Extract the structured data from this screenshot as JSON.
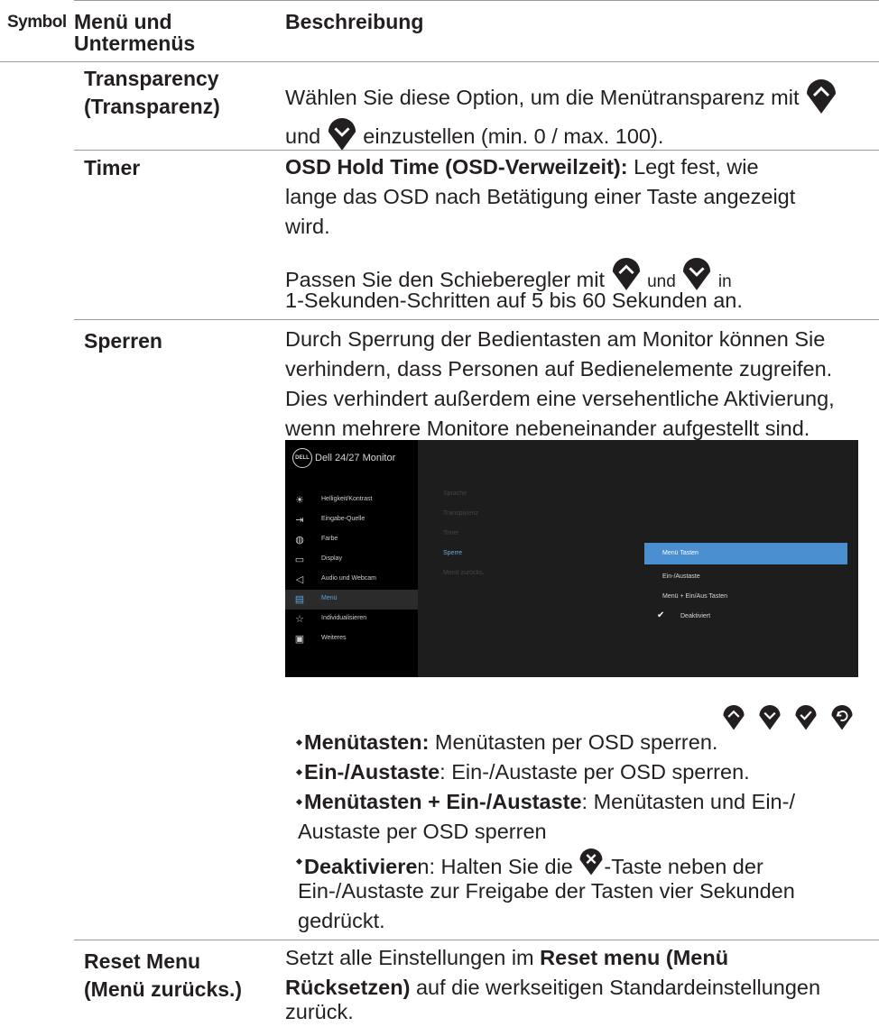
{
  "header": {
    "col_symbol": "Symbol",
    "col_menu_line1": "Menü und",
    "col_menu_line2": "Untermenüs",
    "col_desc": "Beschreibung"
  },
  "rows": {
    "transparency": {
      "name_line1": "Transparency",
      "name_line2": "(Transparenz)",
      "desc_part1": "Wählen Sie diese Option, um die Menütransparenz mit",
      "desc_part2": "und",
      "desc_part3": "einzustellen (min. 0 / max. 100)."
    },
    "timer": {
      "name": "Timer",
      "p1_bold": "OSD Hold Time (OSD-Verweilzeit):",
      "p1_line1_rest": " Legt fest, wie",
      "p1_line2": "lange das OSD nach Betätigung einer Taste angezeigt",
      "p1_line3": "wird.",
      "p2_part1": "Passen Sie den Schieberegler mit",
      "p2_und": "und",
      "p2_in": "in",
      "p2_line2": "1-Sekunden-Schritten auf 5 bis 60 Sekunden an."
    },
    "sperren": {
      "name": "Sperren",
      "line1": "Durch Sperrung der Bedientasten am Monitor können Sie",
      "line2": "verhindern, dass Personen auf Bedienelemente zugreifen.",
      "line3": "Dies verhindert außerdem eine versehentliche Aktivierung,",
      "line4": "wenn mehrere Monitore nebeneinander aufgestellt sind.",
      "osd": {
        "logo": "DELL",
        "title": "Dell 24/27 Monitor",
        "menu": [
          "Helligkeit/Kontrast",
          "Eingabe-Quelle",
          "Farbe",
          "Display",
          "Audio und Webcam",
          "Menü",
          "Individualisieren",
          "Weiteres"
        ],
        "submenu": [
          "Sprache",
          "Transparenz",
          "Timer",
          "Sperre",
          "Menü zurücks."
        ],
        "options": [
          "Menü Tasten",
          "Ein-/Austaste",
          "Menü + Ein/Aus Tasten",
          "Deaktiviert"
        ]
      },
      "b1_bold": "Menütasten:",
      "b1_rest": " Menütasten per OSD sperren.",
      "b2_bold": "Ein-/Austaste",
      "b2_rest": ": Ein-/Austaste per OSD sperren.",
      "b3_bold": "Menütasten + Ein-/Austaste",
      "b3_rest": ": Menütasten und Ein-/",
      "b3_line2": "Austaste per OSD sperren",
      "b4_bold": "Deaktiviere",
      "b4_rest1": "n: Halten Sie die",
      "b4_rest2": "-Taste neben der",
      "b4_line2": "Ein-/Austaste zur Freigabe der Tasten vier Sekunden",
      "b4_line3": "gedrückt."
    },
    "reset": {
      "name_line1": "Reset Menu",
      "name_line2": "(Menü zurücks.)",
      "line1_pre": "Setzt alle Einstellungen im ",
      "line1_bold": "Reset menu (Menü",
      "line2_bold": "Rücksetzen)",
      "line2_rest": " auf die werkseitigen Standardeinstellungen",
      "line3": "zurück."
    }
  }
}
